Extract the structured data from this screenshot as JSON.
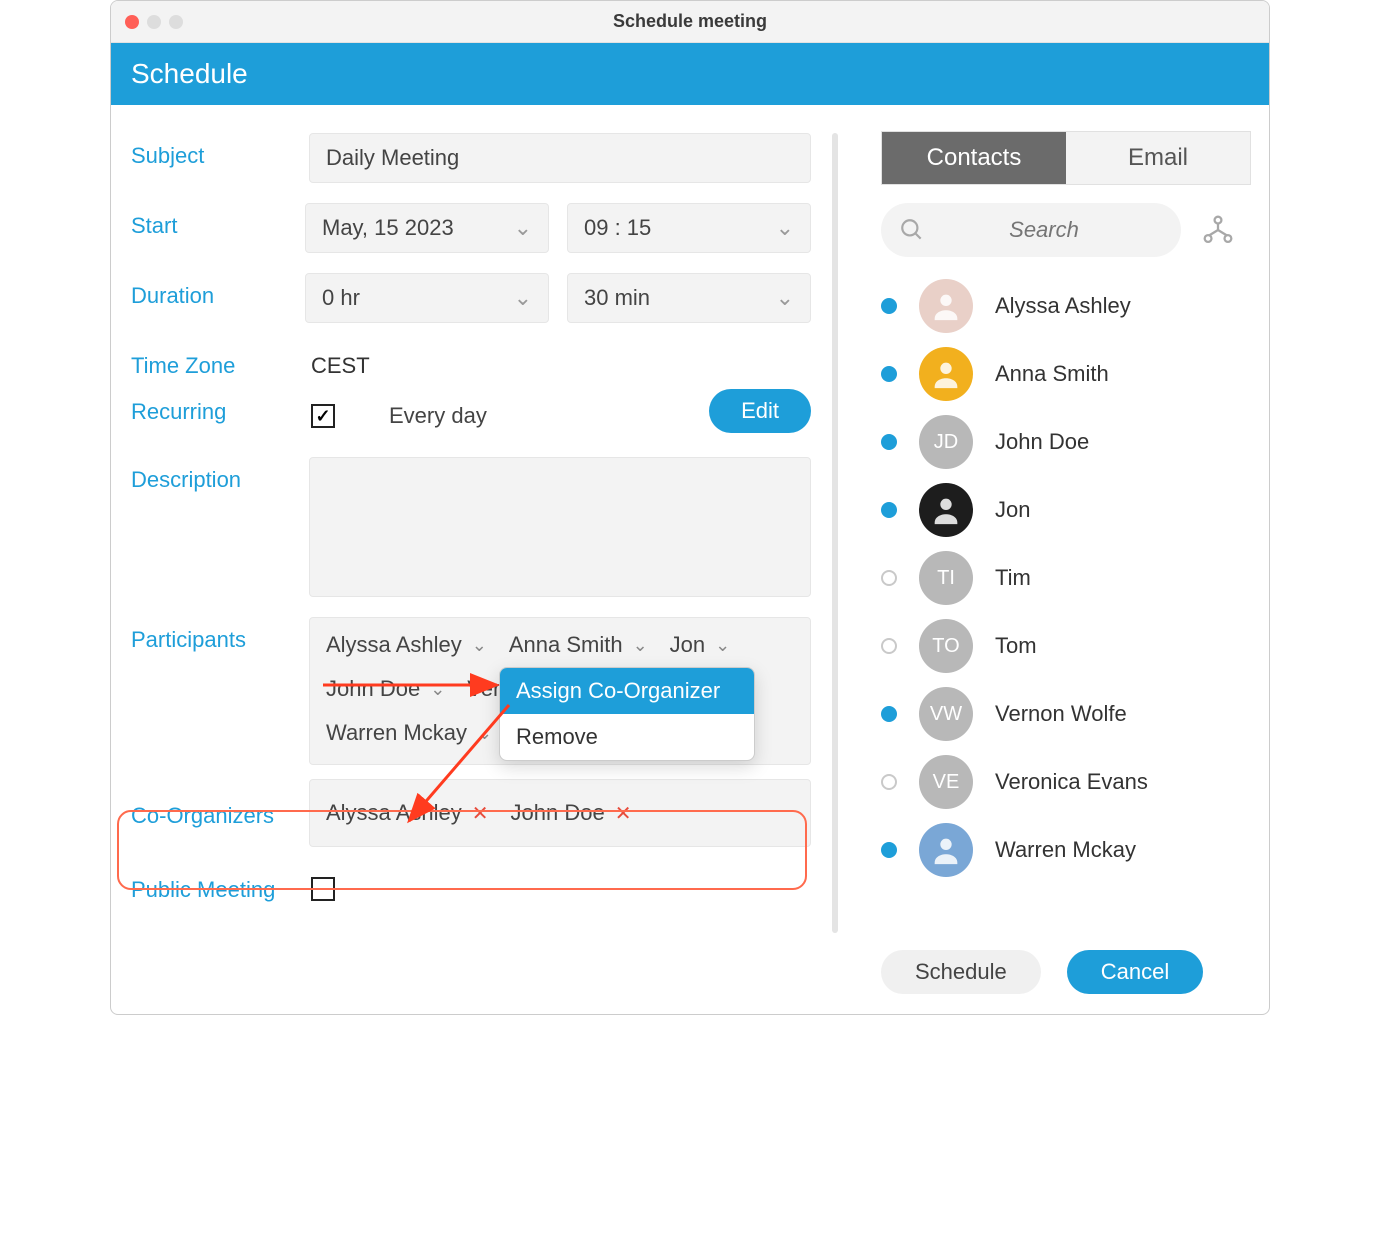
{
  "window": {
    "title": "Schedule meeting"
  },
  "banner": {
    "title": "Schedule"
  },
  "labels": {
    "subject": "Subject",
    "start": "Start",
    "duration": "Duration",
    "timezone": "Time Zone",
    "recurring": "Recurring",
    "description": "Description",
    "participants": "Participants",
    "coorganizers": "Co-Organizers",
    "public": "Public Meeting"
  },
  "form": {
    "subject": "Daily Meeting",
    "start_date": "May, 15 2023",
    "start_time": "09 :  15",
    "duration_hr": "0   hr",
    "duration_min": "30   min",
    "timezone": "CEST",
    "recurring_text": "Every day",
    "edit_label": "Edit"
  },
  "participants": [
    {
      "name": "Alyssa Ashley"
    },
    {
      "name": "Anna Smith"
    },
    {
      "name": "Jon"
    },
    {
      "name": "John Doe"
    },
    {
      "name": "Vernon Wolfe"
    },
    {
      "name": "Warren Mckay"
    }
  ],
  "coorganizers": [
    {
      "name": "Alyssa Ashley"
    },
    {
      "name": "John Doe"
    }
  ],
  "context_menu": {
    "assign": "Assign Co-Organizer",
    "remove": "Remove"
  },
  "tabs": {
    "contacts": "Contacts",
    "email": "Email"
  },
  "search": {
    "placeholder": "Search"
  },
  "contacts": [
    {
      "name": "Alyssa Ashley",
      "status": "online",
      "avatar_type": "photo",
      "bg": "#e9d0c8"
    },
    {
      "name": "Anna Smith",
      "status": "online",
      "avatar_type": "photo",
      "bg": "#f2b01e"
    },
    {
      "name": "John Doe",
      "status": "online",
      "avatar_type": "initials",
      "initials": "JD",
      "bg": "#b8b8b8"
    },
    {
      "name": "Jon",
      "status": "online",
      "avatar_type": "photo",
      "bg": "#1d1d1d"
    },
    {
      "name": "Tim",
      "status": "offline",
      "avatar_type": "initials",
      "initials": "TI",
      "bg": "#b8b8b8"
    },
    {
      "name": "Tom",
      "status": "offline",
      "avatar_type": "initials",
      "initials": "TO",
      "bg": "#b8b8b8"
    },
    {
      "name": "Vernon Wolfe",
      "status": "online",
      "avatar_type": "initials",
      "initials": "VW",
      "bg": "#b8b8b8"
    },
    {
      "name": "Veronica Evans",
      "status": "offline",
      "avatar_type": "initials",
      "initials": "VE",
      "bg": "#b8b8b8"
    },
    {
      "name": "Warren Mckay",
      "status": "online",
      "avatar_type": "photo",
      "bg": "#7aa7d6"
    }
  ],
  "footer": {
    "schedule": "Schedule",
    "cancel": "Cancel"
  }
}
